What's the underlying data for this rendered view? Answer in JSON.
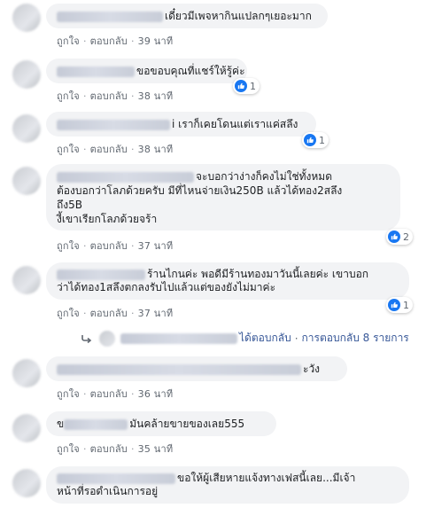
{
  "labels": {
    "like": "ถูกใจ",
    "reply": "ตอบกลับ"
  },
  "comments": [
    {
      "text": "เดี๋ยวมีเพจหากินแปลกๆเยอะมาก",
      "time": "39 นาที"
    },
    {
      "text": "ขอขอบคุณที่แชร์ให้รู้ค่ะ",
      "time": "38 นาที",
      "reactions": "1"
    },
    {
      "text": "i เราก็เคยโดนแต่เราแค่สลึง",
      "time": "38 นาที",
      "reactions": "1"
    },
    {
      "line1": "จะบอกว่าง่างก็คงไม่ใช่ทั้งหมด",
      "line2": "ต้องบอกว่าโลภด้วยครับ มีที่ไหนจ่ายเงิน250B แล้วได้ทอง2สลึง",
      "line3": "ถึง5B",
      "line4": "งี้เขาเรียกโลภด้วยจร้า",
      "time": "37 นาที",
      "reactions": "2"
    },
    {
      "line1": "ร้านไกนค่ะ พอดีมีร้านทองมาวันนี้เลยค่ะ เขาบอก",
      "line2": "ว่าได้ทอง1สลึงตกลงรับไปแล้วแต่ของยังไม่มาค่ะ",
      "time": "37 นาที",
      "reactions": "1"
    },
    {
      "text": "ะวัง",
      "time": "36 นาที"
    },
    {
      "prefix": "ข",
      "text": "มันคล้ายขายของเลย555",
      "time": "35 นาที"
    },
    {
      "line1": "ขอให้ผู้เสียหายแจ้งทางเฟสนี้เลย...มีเจ้า",
      "line2": "หน้าที่รอดำเนินการอยู่"
    }
  ],
  "reply_link": {
    "action": "ได้ตอบกลับ",
    "separator": "·",
    "count_text": "การตอบกลับ 8 รายการ"
  },
  "icons": {
    "like_badge": "thumbs-up-icon",
    "reply_arrow": "reply-arrow-icon"
  },
  "colors": {
    "like_blue": "#1877f2",
    "bubble_bg": "#f2f3f5",
    "meta_text": "#606770",
    "link": "#385898"
  }
}
